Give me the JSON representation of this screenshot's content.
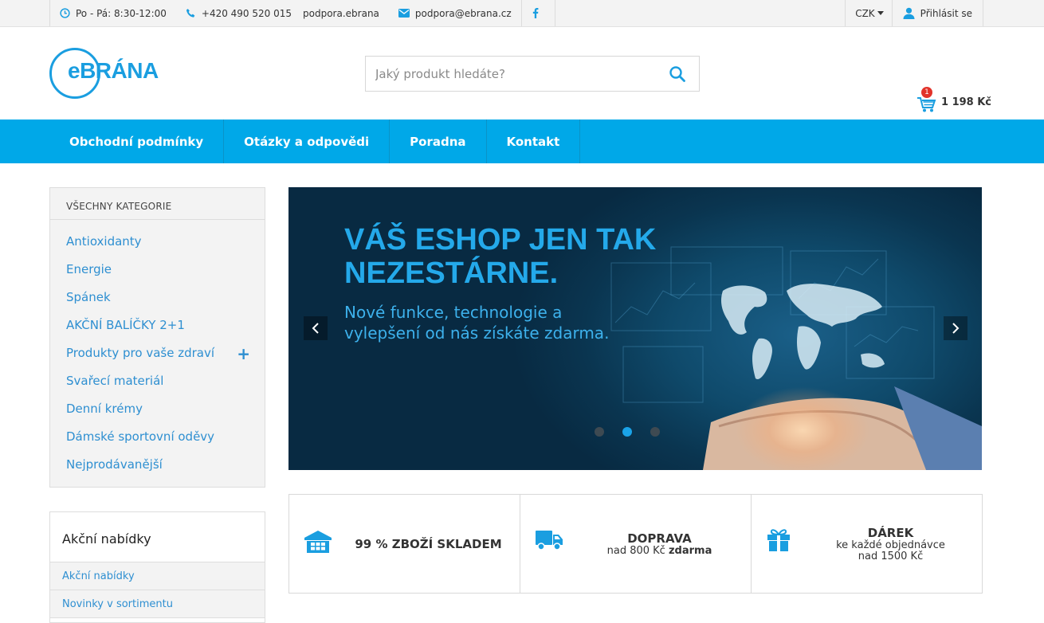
{
  "topbar": {
    "hours": "Po - Pá: 8:30-12:00",
    "phone": "+420 490 520 015",
    "skype": "podpora.ebrana",
    "email": "podpora@ebrana.cz",
    "currency": "CZK",
    "login": "Přihlásit se"
  },
  "header": {
    "logo_text": "eBRÁNA",
    "search_placeholder": "Jaký produkt hledáte?",
    "cart_count": "1",
    "cart_total": "1 198 Kč"
  },
  "nav": {
    "items": [
      "Obchodní podmínky",
      "Otázky a odpovědi",
      "Poradna",
      "Kontakt"
    ]
  },
  "categories": {
    "heading": "VŠECHNY KATEGORIE",
    "items": [
      "Antioxidanty",
      "Energie",
      "Spánek",
      "AKČNÍ BALÍČKY 2+1",
      "Produkty pro vaše zdraví",
      "Svařecí materiál",
      "Denní krémy",
      "Dámské sportovní oděvy",
      "Nejprodávanější"
    ]
  },
  "offers": {
    "heading": "Akční nabídky",
    "items": [
      "Akční nabídky",
      "Novinky v sortimentu"
    ]
  },
  "hero": {
    "title": "VÁŠ ESHOP JEN TAK NEZESTÁRNE.",
    "subtitle": "Nové funkce, technologie a vylepšení od nás získáte zdarma.",
    "active_slide": 2
  },
  "features": {
    "stock": "99 % ZBOŽÍ SKLADEM",
    "shipping_title": "DOPRAVA",
    "shipping_sub": "nad 800 Kč",
    "shipping_sub_bold": "zdarma",
    "gift_title": "DÁREK",
    "gift_sub1": "ke každé objednávce",
    "gift_sub2": "nad 1500 Kč"
  },
  "colors": {
    "brand": "#00a8e8",
    "link": "#2e8fd1",
    "badge": "#e2332a"
  }
}
